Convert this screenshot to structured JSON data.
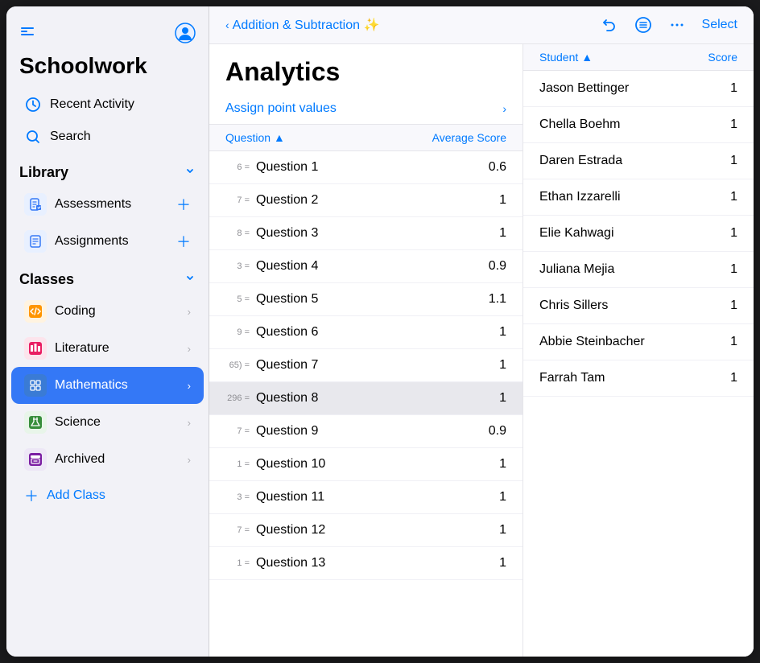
{
  "app": {
    "title": "Schoolwork"
  },
  "sidebar": {
    "nav_items": [
      {
        "id": "recent-activity",
        "label": "Recent Activity",
        "icon": "🕐"
      },
      {
        "id": "search",
        "label": "Search",
        "icon": "🔍"
      }
    ],
    "library": {
      "title": "Library",
      "items": [
        {
          "id": "assessments",
          "label": "Assessments",
          "type": "assessments"
        },
        {
          "id": "assignments",
          "label": "Assignments",
          "type": "assignments"
        }
      ]
    },
    "classes": {
      "title": "Classes",
      "items": [
        {
          "id": "coding",
          "label": "Coding",
          "icon_type": "coding",
          "emoji": "🟧"
        },
        {
          "id": "literature",
          "label": "Literature",
          "icon_type": "literature",
          "emoji": "📊"
        },
        {
          "id": "mathematics",
          "label": "Mathematics",
          "icon_type": "mathematics",
          "emoji": "📋",
          "active": true
        },
        {
          "id": "science",
          "label": "Science",
          "icon_type": "science",
          "emoji": "✂"
        },
        {
          "id": "archived",
          "label": "Archived",
          "icon_type": "archived",
          "emoji": "📦"
        }
      ]
    },
    "add_class_label": "Add Class"
  },
  "header": {
    "back_label": "Addition & Subtraction ✨",
    "actions": {
      "undo": "↩",
      "list": "☰",
      "more": "•••",
      "select": "Select"
    }
  },
  "analytics": {
    "title": "Analytics",
    "assign_point_values_label": "Assign point values",
    "columns": {
      "question": "Question",
      "avg_score": "Average Score",
      "student": "Student",
      "score": "Score"
    },
    "questions": [
      {
        "prefix": "6 =",
        "name": "Question 1",
        "score": "0.6"
      },
      {
        "prefix": "7 =",
        "name": "Question 2",
        "score": "1"
      },
      {
        "prefix": "8 =",
        "name": "Question 3",
        "score": "1"
      },
      {
        "prefix": "3 =",
        "name": "Question 4",
        "score": "0.9"
      },
      {
        "prefix": "5 =",
        "name": "Question 5",
        "score": "1.1"
      },
      {
        "prefix": "9 =",
        "name": "Question 6",
        "score": "1"
      },
      {
        "prefix": "65) =",
        "name": "Question 7",
        "score": "1"
      },
      {
        "prefix": "296 =",
        "name": "Question 8",
        "score": "1",
        "selected": true
      },
      {
        "prefix": "7 =",
        "name": "Question 9",
        "score": "0.9"
      },
      {
        "prefix": "1 =",
        "name": "Question 10",
        "score": "1"
      },
      {
        "prefix": "3 =",
        "name": "Question 11",
        "score": "1"
      },
      {
        "prefix": "7 =",
        "name": "Question 12",
        "score": "1"
      },
      {
        "prefix": "1 =",
        "name": "Question 13",
        "score": "1"
      }
    ],
    "students": [
      {
        "name": "Jason Bettinger",
        "score": "1"
      },
      {
        "name": "Chella Boehm",
        "score": "1"
      },
      {
        "name": "Daren Estrada",
        "score": "1"
      },
      {
        "name": "Ethan Izzarelli",
        "score": "1"
      },
      {
        "name": "Elie Kahwagi",
        "score": "1"
      },
      {
        "name": "Juliana Mejia",
        "score": "1"
      },
      {
        "name": "Chris Sillers",
        "score": "1"
      },
      {
        "name": "Abbie Steinbacher",
        "score": "1"
      },
      {
        "name": "Farrah Tam",
        "score": "1"
      }
    ]
  }
}
